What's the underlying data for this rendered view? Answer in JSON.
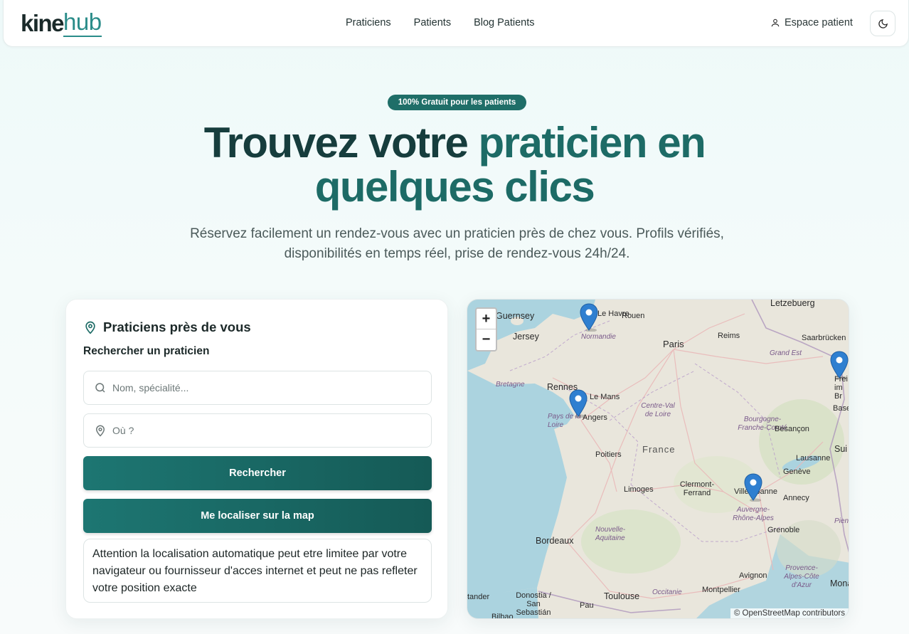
{
  "header": {
    "logo_part1": "kine",
    "logo_part2": "hub",
    "nav": [
      "Praticiens",
      "Patients",
      "Blog Patients"
    ],
    "espace_patient": "Espace patient",
    "theme_icon": "moon-icon"
  },
  "hero": {
    "badge": "100% Gratuit pour les patients",
    "title_line1_a": "Trouvez votre",
    "title_line1_b": "praticien en",
    "title_line2": "quelques clics",
    "subtitle": "Réservez facilement un rendez-vous avec un praticien près de chez vous. Profils vérifiés, disponibilités en temps réel, prise de rendez-vous 24h/24."
  },
  "search_card": {
    "title": "Praticiens près de vous",
    "subtitle": "Rechercher un praticien",
    "name_placeholder": "Nom, spécialité...",
    "location_placeholder": "Où ?",
    "search_button": "Rechercher",
    "locate_button": "Me localiser sur la map",
    "notice": "Attention la localisation automatique peut etre limitee par votre navigateur ou fournisseur d'acces internet et peut ne pas refleter votre position exacte"
  },
  "map": {
    "zoom_in": "+",
    "zoom_out": "−",
    "attribution": "© OpenStreetMap contributors",
    "country_label": "France",
    "cities": [
      "Guernsey",
      "Jersey",
      "Le Havre",
      "Rouen",
      "Paris",
      "Reims",
      "Letzebuerg",
      "Saarbrücken",
      "Rennes",
      "Le Mans",
      "Angers",
      "Poitiers",
      "Limoges",
      "Clermont-Ferrand",
      "Villeurbanne",
      "Annecy",
      "Genève",
      "Lausanne",
      "Besançon",
      "Grenoble",
      "Bordeaux",
      "Toulouse",
      "Montpellier",
      "Avignon",
      "Monaco",
      "Pau",
      "Donostia / San Sebastián",
      "Bilbao",
      "Base",
      "Frei im Br",
      "Sui",
      "Pien",
      "tander"
    ],
    "regions": [
      "Normandie",
      "Bretagne",
      "Pays de la Loire",
      "Centre-Val de Loire",
      "Grand Est",
      "Bourgogne-Franche-Comté",
      "Nouvelle-Aquitaine",
      "Auvergne-Rhône-Alpes",
      "Occitanie",
      "Provence-Alpes-Côte d'Azur"
    ],
    "marker_icon": "map-marker-icon",
    "marker_count": 4
  }
}
